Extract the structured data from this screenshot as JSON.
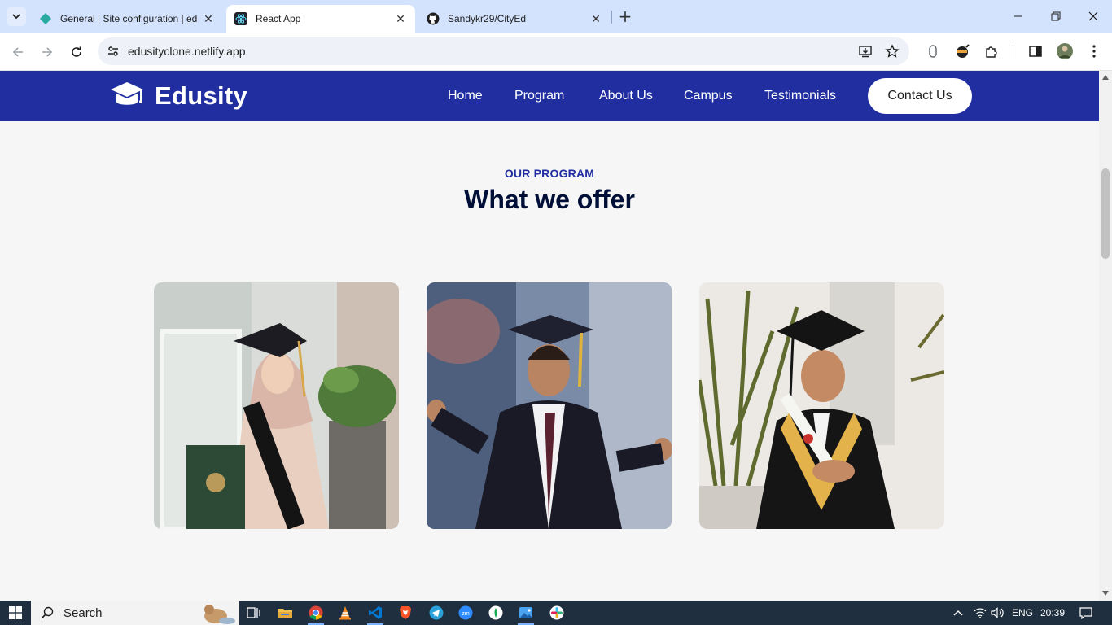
{
  "browser": {
    "tabs": [
      {
        "title": "General | Site configuration | ed",
        "favicon": "netlify-diamond-icon",
        "active": false
      },
      {
        "title": "React App",
        "favicon": "react-icon",
        "active": true
      },
      {
        "title": "Sandykr29/CityEd",
        "favicon": "github-icon",
        "active": false
      }
    ],
    "url": "edusityclone.netlify.app"
  },
  "site": {
    "logo_text": "Edusity",
    "nav": {
      "home": "Home",
      "program": "Program",
      "about": "About Us",
      "campus": "Campus",
      "testimonials": "Testimonials",
      "contact": "Contact Us"
    },
    "section": {
      "subtitle": "OUR PROGRAM",
      "title": "What we offer"
    },
    "programs": [
      {
        "image": "graduate-woman-hijab-photo"
      },
      {
        "image": "graduate-man-waving-photo"
      },
      {
        "image": "graduate-man-diploma-photo"
      }
    ],
    "colors": {
      "brand": "#212ea0",
      "heading": "#000f38",
      "background": "#f6f6f6"
    }
  },
  "taskbar": {
    "search_placeholder": "Search",
    "language": "ENG",
    "time": "20:39"
  }
}
